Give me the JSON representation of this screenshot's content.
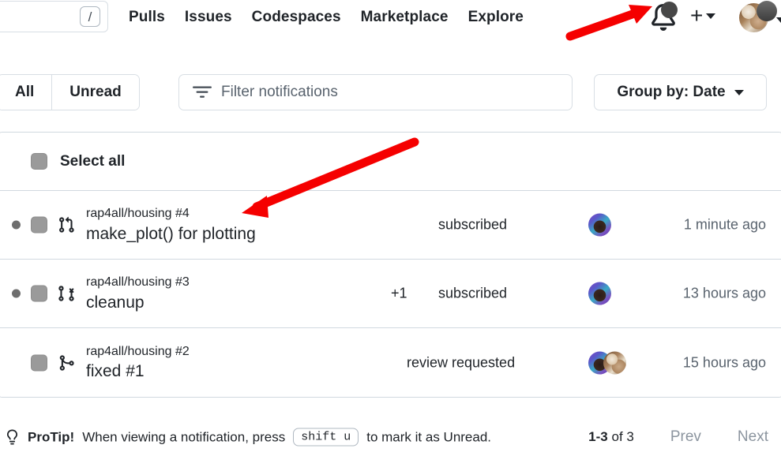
{
  "header": {
    "search": {
      "placeholder": "",
      "value": "",
      "shortcut_key": "/"
    },
    "nav_items": [
      {
        "label": "Pulls"
      },
      {
        "label": "Issues"
      },
      {
        "label": "Codespaces"
      },
      {
        "label": "Marketplace"
      },
      {
        "label": "Explore"
      }
    ],
    "bell_icon": "bell-icon",
    "bell_has_unread_dot": true,
    "create_new_icon": "plus-icon",
    "account_avatar": "avatar-cat"
  },
  "filterbar": {
    "tabs": [
      {
        "label": "All",
        "selected": true
      },
      {
        "label": "Unread",
        "selected": false
      }
    ],
    "filter_icon": "filter-icon",
    "filter_placeholder": "Filter notifications",
    "filter_value": "",
    "group_by_label": "Group by: Date"
  },
  "list": {
    "select_all_label": "Select all",
    "rows": [
      {
        "unread": true,
        "type_icon": "pull-request-open-icon",
        "repo": "rap4all/housing #4",
        "title": "make_plot() for plotting",
        "extra_count": "",
        "reason": "subscribed",
        "avatars": [
          "avatar-purple"
        ],
        "timestamp": "1 minute ago"
      },
      {
        "unread": true,
        "type_icon": "pull-request-closed-icon",
        "repo": "rap4all/housing #3",
        "title": "cleanup",
        "extra_count": "+1",
        "reason": "subscribed",
        "avatars": [
          "avatar-purple"
        ],
        "timestamp": "13 hours ago"
      },
      {
        "unread": false,
        "type_icon": "git-merge-icon",
        "repo": "rap4all/housing #2",
        "title": "fixed #1",
        "extra_count": "",
        "reason": "review requested",
        "avatars": [
          "avatar-purple",
          "avatar-cat"
        ],
        "timestamp": "15 hours ago"
      }
    ]
  },
  "footer": {
    "tip_icon": "lightbulb-icon",
    "tip_label": "ProTip!",
    "tip_text_before": "When viewing a notification, press",
    "tip_key": "shift u",
    "tip_text_after": "to mark it as Unread.",
    "page_range": "1-3",
    "page_total": "of 3",
    "prev_label": "Prev",
    "next_label": "Next"
  },
  "annotations": {
    "arrow_color": "#F50000",
    "arrow_1_target": "bell-icon",
    "arrow_2_target": "notification-row-1"
  }
}
